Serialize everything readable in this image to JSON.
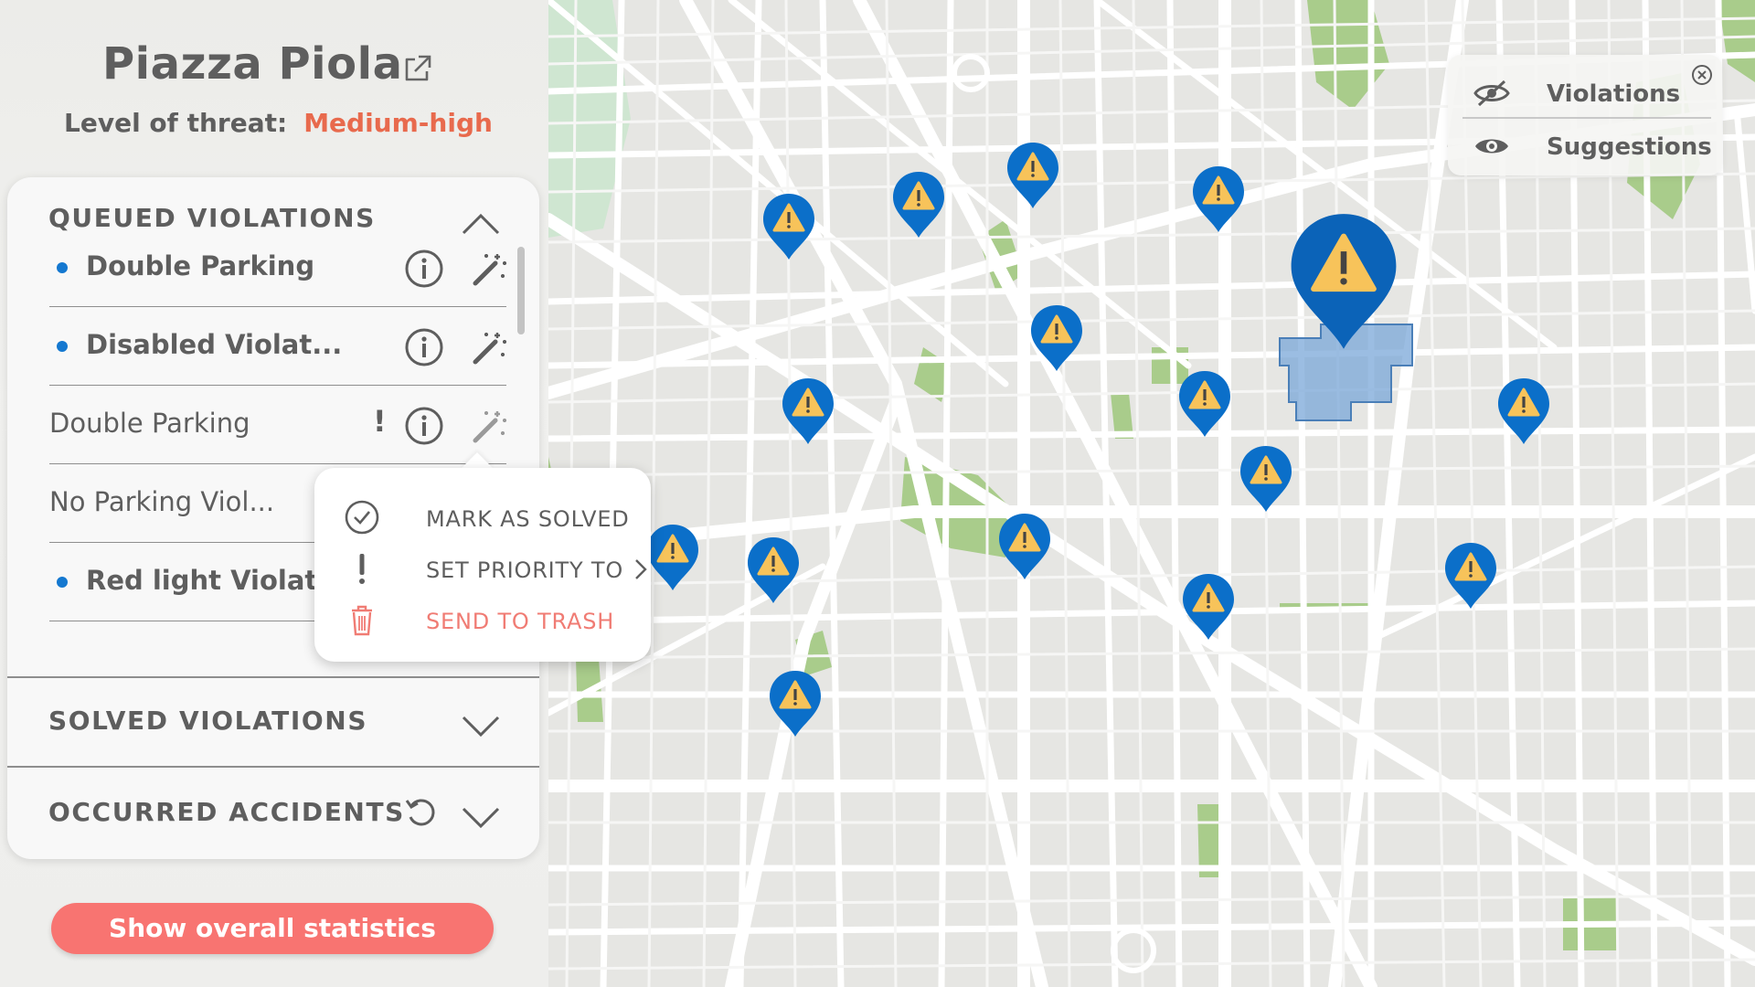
{
  "place": {
    "title": "Piazza Piola",
    "threat_label": "Level of threat:",
    "threat_value": "Medium-high",
    "threat_color": "#e86a4d"
  },
  "sections": {
    "queued": "QUEUED VIOLATIONS",
    "solved": "SOLVED VIOLATIONS",
    "accidents": "OCCURRED ACCIDENTS"
  },
  "violations": [
    {
      "label": "Double Parking",
      "unread": true
    },
    {
      "label": "Disabled  Violat...",
      "unread": true
    },
    {
      "label": "Double Parking",
      "unread": false,
      "priority": "!"
    },
    {
      "label": "No Parking Viol...",
      "unread": false
    },
    {
      "label": "Red light Violat...",
      "unread": true
    }
  ],
  "context_menu": {
    "mark_solved": "MARK AS SOLVED",
    "set_priority": "SET PRIORITY TO",
    "trash": "SEND TO TRASH"
  },
  "stats_button": "Show overall statistics",
  "layers": {
    "violations": "Violations",
    "suggestions": "Suggestions"
  },
  "colors": {
    "accent_blue": "#1478d0",
    "marker_blue": "#0b6fc9",
    "marker_warning": "#f7c35a",
    "button_red": "#f87471",
    "trash_red": "#f07c74",
    "park_green": "#a9cc8b"
  },
  "icons": [
    "external-link-icon",
    "info-icon",
    "magic-wand-icon",
    "chevron-up-icon",
    "chevron-down-icon",
    "refresh-icon",
    "check-circle-icon",
    "exclamation-icon",
    "chevron-right-icon",
    "trash-icon",
    "eye-off-icon",
    "eye-icon",
    "close-icon",
    "warning-marker-icon"
  ]
}
